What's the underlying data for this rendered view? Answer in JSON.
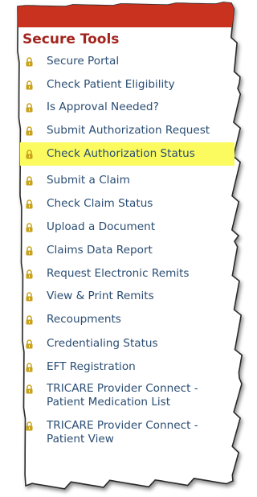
{
  "colors": {
    "top_bar": "#c8321f",
    "title": "#a3251e",
    "link": "#2a4d73",
    "lock": "#c8a21a",
    "highlight": "#fbfb5f",
    "edge": "#2a2a2a"
  },
  "secure_tools": {
    "title": "Secure Tools",
    "icon": "lock-icon",
    "items": [
      {
        "label": "Secure Portal"
      },
      {
        "label": "Check Patient Eligibility"
      },
      {
        "label": "Is Approval Needed?"
      },
      {
        "label": "Submit Authorization Request"
      },
      {
        "label": "Check Authorization Status",
        "highlighted": true
      },
      {
        "label": "Submit a Claim"
      },
      {
        "label": "Check Claim Status"
      },
      {
        "label": "Upload a Document"
      },
      {
        "label": "Claims Data Report"
      },
      {
        "label": "Request Electronic Remits"
      },
      {
        "label": "View & Print Remits"
      },
      {
        "label": "Recoupments"
      },
      {
        "label": "Credentialing Status"
      },
      {
        "label": "EFT Registration"
      },
      {
        "label": "TRICARE Provider Connect -",
        "label_line2": "Patient Medication List"
      },
      {
        "label": "TRICARE Provider Connect -",
        "label_line2": "Patient View"
      }
    ]
  }
}
